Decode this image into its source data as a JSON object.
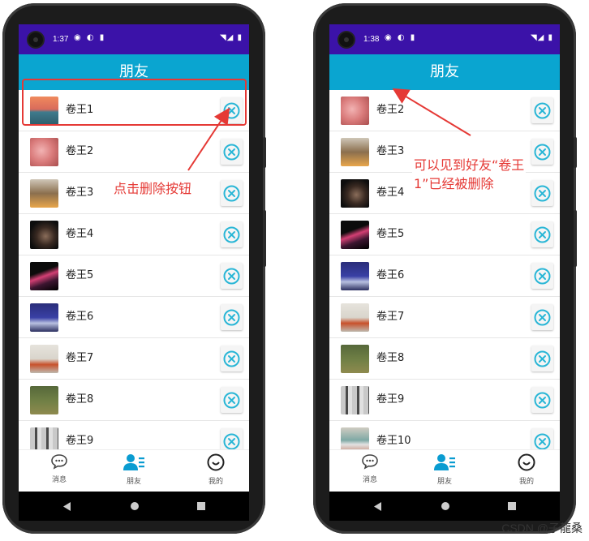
{
  "left_phone": {
    "status_time": "1:37",
    "title": "朋友",
    "friends": [
      "卷王1",
      "卷王2",
      "卷王3",
      "卷王4",
      "卷王5",
      "卷王6",
      "卷王7",
      "卷王8",
      "卷王9"
    ],
    "nav": [
      "消息",
      "朋友",
      "我的"
    ]
  },
  "right_phone": {
    "status_time": "1:38",
    "title": "朋友",
    "friends": [
      "卷王2",
      "卷王3",
      "卷王4",
      "卷王5",
      "卷王6",
      "卷王7",
      "卷王8",
      "卷王9",
      "卷王10"
    ],
    "nav": [
      "消息",
      "朋友",
      "我的"
    ]
  },
  "annotations": {
    "click_delete": "点击删除按钮",
    "deleted_line1": "可以见到好友“卷王",
    "deleted_line2": "1”已经被删除"
  },
  "watermark": "CSDN @子龍桑",
  "colors": {
    "status_bar": "#3b12a8",
    "title_bar": "#0aa5d0",
    "delete_icon": "#29b6d6",
    "annotation": "#e53935"
  },
  "icons": {
    "delete": "circle-x-icon",
    "nav_messages": "chat-bubble-icon",
    "nav_friends": "contacts-icon",
    "nav_me": "smile-circle-icon"
  }
}
